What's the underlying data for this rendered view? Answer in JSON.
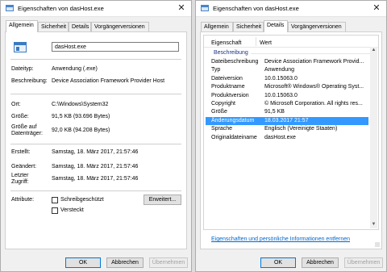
{
  "left_window": {
    "title": "Eigenschaften von dasHost.exe",
    "tabs": [
      "Allgemein",
      "Sicherheit",
      "Details",
      "Vorgängerversionen"
    ],
    "filename": "dasHost.exe",
    "fields": {
      "type_label": "Dateityp:",
      "type_value": "Anwendung (.exe)",
      "desc_label": "Beschreibung:",
      "desc_value": "Device Association Framework Provider Host",
      "location_label": "Ort:",
      "location_value": "C:\\Windows\\System32",
      "size_label": "Größe:",
      "size_value": "91,5 KB (93.696 Bytes)",
      "disksize_label_1": "Größe auf",
      "disksize_label_2": "Datenträger:",
      "disksize_value": "92,0 KB (94.208 Bytes)",
      "created_label": "Erstellt:",
      "created_value": "Samstag, 18. März 2017, 21:57:46",
      "modified_label": "Geändert:",
      "modified_value": "Samstag, 18. März 2017, 21:57:46",
      "accessed_label_1": "Letzter",
      "accessed_label_2": "Zugriff:",
      "accessed_value": "Samstag, 18. März 2017, 21:57:46",
      "attributes_label": "Attribute:",
      "readonly_label": "Schreibgeschützt",
      "hidden_label": "Versteckt",
      "advanced_button": "Erweitert..."
    },
    "buttons": {
      "ok": "OK",
      "cancel": "Abbrechen",
      "apply": "Übernehmen"
    }
  },
  "right_window": {
    "title": "Eigenschaften von dasHost.exe",
    "tabs": [
      "Allgemein",
      "Sicherheit",
      "Details",
      "Vorgängerversionen"
    ],
    "columns": {
      "property": "Eigenschaft",
      "value": "Wert"
    },
    "group": "Beschreibung",
    "rows": [
      {
        "p": "Dateibeschreibung",
        "v": "Device Association Framework Provid..."
      },
      {
        "p": "Typ",
        "v": "Anwendung"
      },
      {
        "p": "Dateiversion",
        "v": "10.0.15063.0"
      },
      {
        "p": "Produktname",
        "v": "Microsoft® Windows® Operating Syst..."
      },
      {
        "p": "Produktversion",
        "v": "10.0.15063.0"
      },
      {
        "p": "Copyright",
        "v": "© Microsoft Corporation. All rights res..."
      },
      {
        "p": "Größe",
        "v": "91,5 KB"
      },
      {
        "p": "Änderungsdatum",
        "v": "18.03.2017 21:57"
      },
      {
        "p": "Sprache",
        "v": "Englisch (Vereinigte Staaten)"
      },
      {
        "p": "Originaldateiname",
        "v": "dasHost.exe"
      }
    ],
    "selected_row_index": 7,
    "link": "Eigenschaften und persönliche Informationen entfernen",
    "buttons": {
      "ok": "OK",
      "cancel": "Abbrechen",
      "apply": "Übernehmen"
    }
  }
}
